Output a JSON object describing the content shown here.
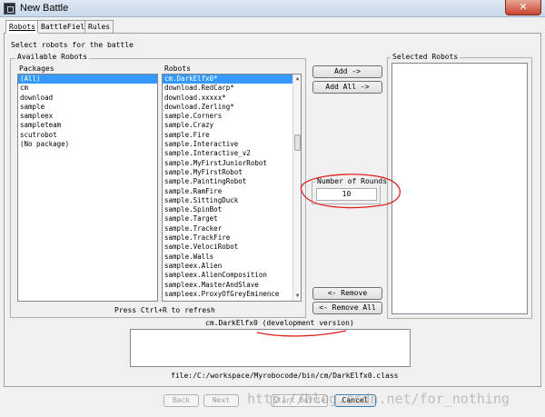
{
  "window": {
    "title": "New Battle",
    "close_glyph": "✕"
  },
  "tabs": [
    {
      "label": "Robots",
      "active": true
    },
    {
      "label": "BattleField",
      "active": false
    },
    {
      "label": "Rules",
      "active": false
    }
  ],
  "robots_tab": {
    "instruction": "Select robots for the battle",
    "available_group_label": "Available Robots",
    "packages_header": "Packages",
    "robots_header": "Robots",
    "packages": [
      "(All)",
      "cm",
      "download",
      "sample",
      "sampleex",
      "sampleteam",
      "scutrobot",
      "(No package)"
    ],
    "robots": [
      "cm.DarkElfx0*",
      "download.RedCarp*",
      "download.xxxxx*",
      "download.Zerling*",
      "sample.Corners",
      "sample.Crazy",
      "sample.Fire",
      "sample.Interactive",
      "sample.Interactive_v2",
      "sample.MyFirstJuniorRobot",
      "sample.MyFirstRobot",
      "sample.PaintingRobot",
      "sample.RamFire",
      "sample.SittingDuck",
      "sample.SpinBot",
      "sample.Target",
      "sample.Tracker",
      "sample.TrackFire",
      "sample.VelociRobot",
      "sample.Walls",
      "sampleex.Alien",
      "sampleex.AlienComposition",
      "sampleex.MasterAndSlave",
      "sampleex.ProxyOfGreyEminence"
    ],
    "refresh_hint": "Press Ctrl+R to refresh",
    "add_button": "Add ->",
    "add_all_button": "Add All ->",
    "rounds_label": "Number of Rounds",
    "rounds_value": "10",
    "remove_button": "<- Remove",
    "remove_all_button": "<- Remove All",
    "selected_group_label": "Selected Robots",
    "selected_robots": [],
    "selected_robot_name": "cm.DarkElfx0 (development version)",
    "description": "",
    "file_path": "file:/C:/workspace/Myrobocode/bin/cm/DarkElfx0.class"
  },
  "footer": {
    "back": "Back",
    "next": "Next",
    "start": "Start Battle",
    "cancel": "Cancel"
  },
  "watermark": "http://blog.csdn.net/for_nothing",
  "annotation_color": "#e02020"
}
